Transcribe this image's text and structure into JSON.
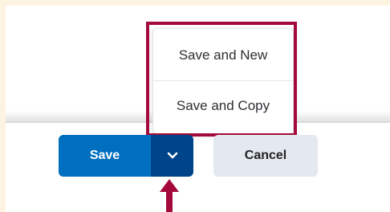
{
  "menu": {
    "items": [
      {
        "label": "Save and New"
      },
      {
        "label": "Save and Copy"
      }
    ]
  },
  "buttons": {
    "save_label": "Save",
    "cancel_label": "Cancel",
    "dropdown_icon": "chevron-down-icon"
  },
  "colors": {
    "background": "#fdf3e1",
    "save_primary": "#006fbf",
    "save_dropdown": "#004489",
    "cancel": "#e4e9ef",
    "highlight": "#a3093a"
  }
}
